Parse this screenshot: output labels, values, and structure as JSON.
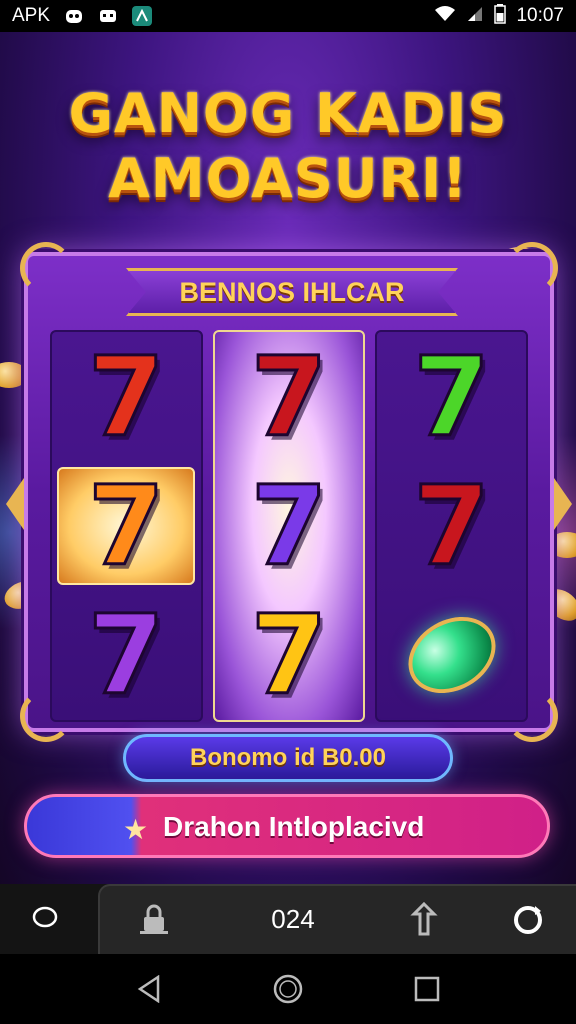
{
  "status_bar": {
    "carrier_label": "APK",
    "clock": "10:07",
    "icons": [
      "gamepad-icon",
      "controller-icon",
      "app-icon",
      "wifi-icon",
      "signal-icon",
      "battery-icon"
    ]
  },
  "title": {
    "line1": "GANOG KADIS",
    "line2": "AMOASURI!"
  },
  "machine": {
    "banner": "BENNOS IHLCAR",
    "reels": [
      {
        "symbols": [
          "red-seven",
          "orange-seven",
          "purple-seven"
        ]
      },
      {
        "symbols": [
          "red-seven",
          "purple-seven",
          "yellow-seven"
        ]
      },
      {
        "symbols": [
          "green-seven",
          "red-seven",
          "green-gem"
        ]
      }
    ]
  },
  "bonus": {
    "label": "Bonomo id B0.00"
  },
  "action_button": {
    "label": "Drahon Intloplacivd"
  },
  "game_bar": {
    "count": "024"
  },
  "nav": {
    "icons": [
      "back-icon",
      "home-icon",
      "recents-icon"
    ]
  },
  "colors": {
    "title_gold": "#ffc928",
    "machine_purple": "#5a1aa0",
    "pill_blue": "#2a1a9a",
    "action_pink": "#d02088"
  }
}
